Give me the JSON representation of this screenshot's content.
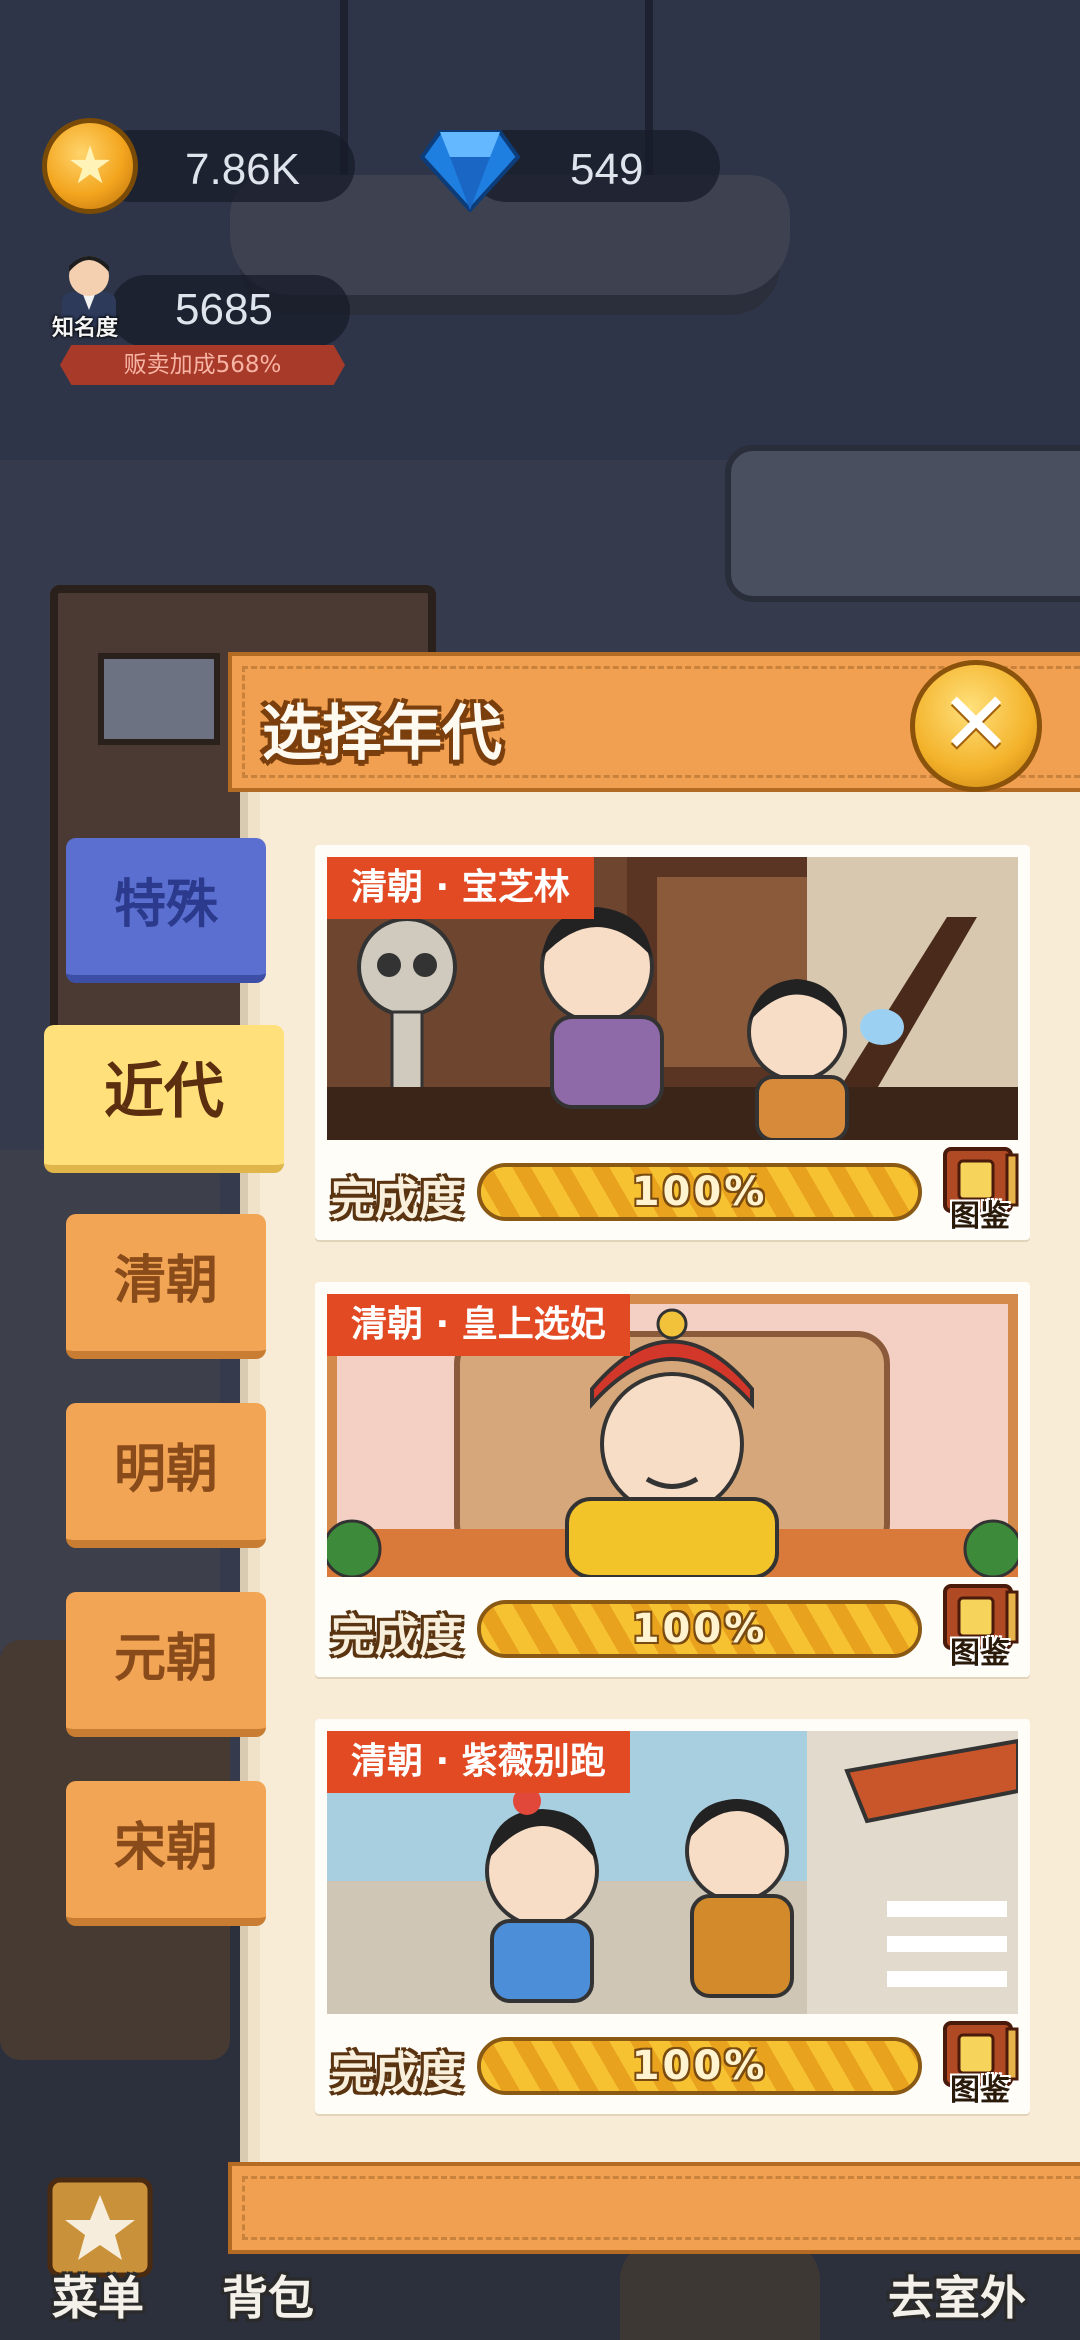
{
  "hud": {
    "coins": "7.86K",
    "gems": "549",
    "fame_label": "知名度",
    "fame": "5685",
    "bonus": "贩卖加成568%"
  },
  "panel": {
    "title": "选择年代",
    "close_icon": "close-x-icon"
  },
  "tabs": [
    {
      "label": "特殊",
      "state": "special"
    },
    {
      "label": "近代",
      "state": "active"
    },
    {
      "label": "清朝",
      "state": "normal"
    },
    {
      "label": "明朝",
      "state": "normal"
    },
    {
      "label": "元朝",
      "state": "normal"
    },
    {
      "label": "宋朝",
      "state": "normal"
    }
  ],
  "cards": [
    {
      "tag": "清朝 · 宝芝林",
      "progress_label": "完成度",
      "progress": 100,
      "progress_text": "100%",
      "gallery": "图鉴"
    },
    {
      "tag": "清朝 · 皇上选妃",
      "progress_label": "完成度",
      "progress": 100,
      "progress_text": "100%",
      "gallery": "图鉴"
    },
    {
      "tag": "清朝 · 紫薇别跑",
      "progress_label": "完成度",
      "progress": 100,
      "progress_text": "100%",
      "gallery": "图鉴"
    }
  ],
  "nav": {
    "menu": "菜单",
    "bag": "背包",
    "outdoor": "去室外"
  },
  "colors": {
    "panel_orange": "#f0a050",
    "tag_red": "#e24a24",
    "tab_active": "#ffe07a",
    "tab_special": "#5b6fd0"
  }
}
